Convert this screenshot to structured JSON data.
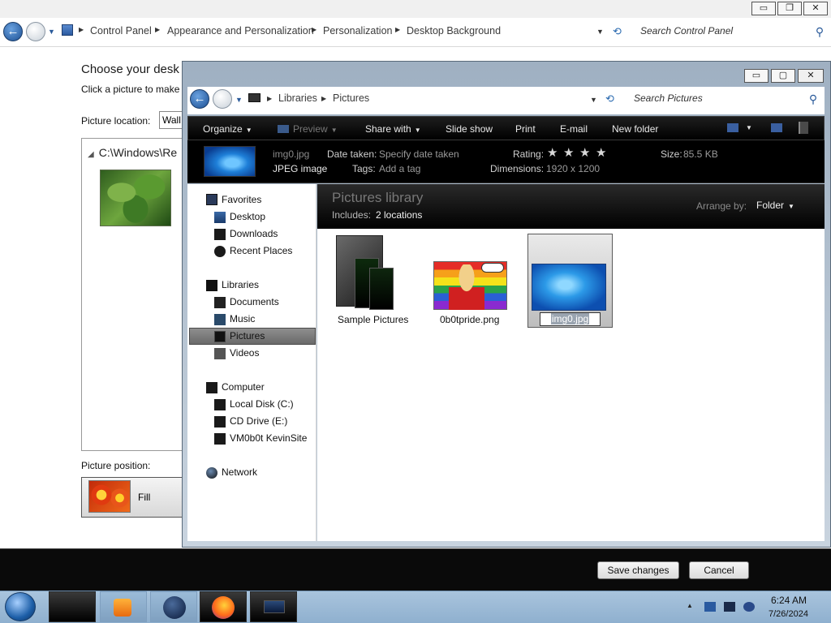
{
  "control_panel": {
    "breadcrumb": [
      "Control Panel",
      "Appearance and Personalization",
      "Personalization",
      "Desktop Background"
    ],
    "search_placeholder": "Search Control Panel",
    "heading": "Choose your desk",
    "subtext": "Click a picture to make",
    "picture_location_label": "Picture location:",
    "picture_location_value": "Wall",
    "gallery_path": "C:\\Windows\\Re",
    "picture_position_label": "Picture position:",
    "picture_position_value": "Fill",
    "caption_buttons": {
      "minimize": "▭",
      "restore": "❐",
      "close": "✕"
    },
    "save_button": "Save changes",
    "cancel_button": "Cancel"
  },
  "explorer": {
    "breadcrumb": [
      "Libraries",
      "Pictures"
    ],
    "search_placeholder": "Search Pictures",
    "caption_buttons": {
      "minimize": "▭",
      "maximize": "▢",
      "close": "✕"
    },
    "toolbar": {
      "organize": "Organize",
      "preview": "Preview",
      "share_with": "Share with",
      "slide_show": "Slide show",
      "print": "Print",
      "email": "E-mail",
      "new_folder": "New folder"
    },
    "details": {
      "file_name": "img0.jpg",
      "file_type": "JPEG image",
      "date_taken_label": "Date taken:",
      "date_taken_value": "Specify date taken",
      "tags_label": "Tags:",
      "tags_value": "Add a tag",
      "rating_label": "Rating:",
      "rating_stars": 5,
      "dimensions_label": "Dimensions:",
      "dimensions_value": "1920 x 1200",
      "size_label": "Size:",
      "size_value": "85.5 KB"
    },
    "nav": {
      "favorites": "Favorites",
      "desktop": "Desktop",
      "downloads": "Downloads",
      "recent_places": "Recent Places",
      "libraries": "Libraries",
      "documents": "Documents",
      "music": "Music",
      "pictures": "Pictures",
      "videos": "Videos",
      "computer": "Computer",
      "local_disk": "Local Disk (C:)",
      "cd_drive": "CD Drive (E:)",
      "vm_share": "VM0b0t KevinSite",
      "network": "Network"
    },
    "library": {
      "title": "Pictures library",
      "includes_label": "Includes:",
      "includes_value": "2 locations",
      "arrange_label": "Arrange by:",
      "arrange_value": "Folder"
    },
    "items": [
      {
        "name": "Sample Pictures",
        "icon": "folder-icon"
      },
      {
        "name": "0b0tpride.png",
        "icon": "image-thumbnail"
      },
      {
        "name": "img0.jpg",
        "icon": "image-thumbnail",
        "selected": true,
        "renaming": true
      }
    ]
  },
  "taskbar": {
    "time": "6:24 AM",
    "date": "7/26/2024",
    "apps": [
      "explorer",
      "media-player",
      "ie-globe",
      "firefox",
      "window-switcher"
    ]
  },
  "colors": {
    "taskbar": "#9bbbd8",
    "toolbar": "#000000",
    "selected_nav": "#7a7a7a"
  }
}
